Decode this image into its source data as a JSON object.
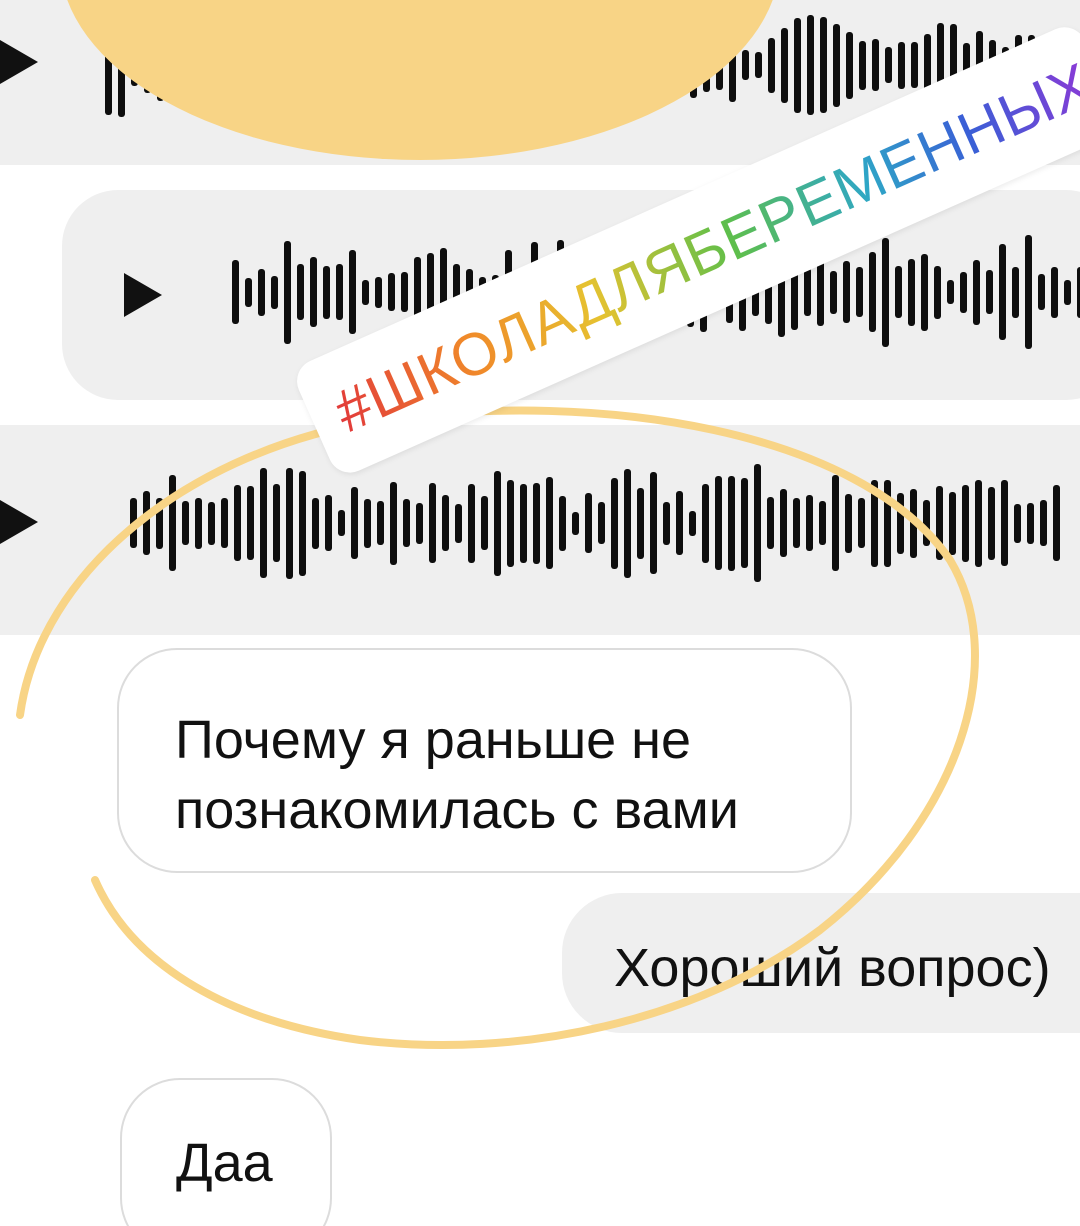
{
  "sticker": {
    "hashtag": "#ШКОЛАДЛЯБЕРЕМЕННЫХ"
  },
  "colors": {
    "highlight": "#f8d486",
    "bubble_gray": "#efefef",
    "bubble_border": "#dcdcdc",
    "text": "#111111",
    "hashtag_gradient": [
      "#e23a3a",
      "#f08a2a",
      "#e6c230",
      "#5fbf4a",
      "#2ea7c6",
      "#3a5fd6",
      "#8a3ad6"
    ]
  },
  "messages": [
    {
      "type": "voice",
      "icon": "play-icon"
    },
    {
      "type": "voice",
      "icon": "play-icon"
    },
    {
      "type": "voice",
      "icon": "play-icon"
    },
    {
      "type": "text",
      "direction": "incoming",
      "text": "Почему я раньше не\nпознакомилась с вами"
    },
    {
      "type": "text",
      "direction": "outgoing",
      "text": "Хороший вопрос)"
    },
    {
      "type": "text",
      "direction": "incoming",
      "text": "Даа"
    }
  ]
}
